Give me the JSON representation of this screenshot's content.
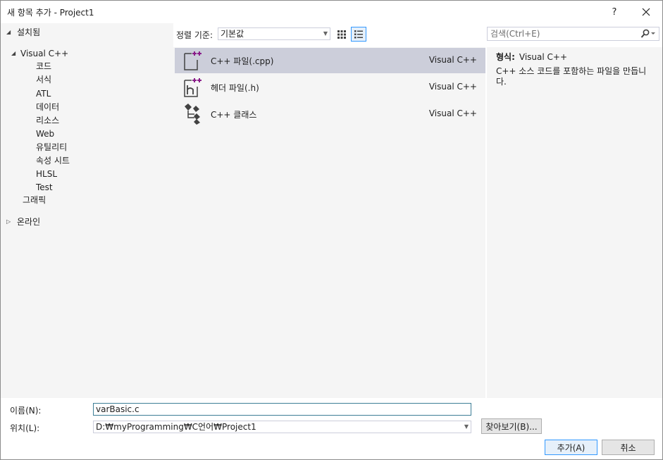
{
  "window": {
    "title": "새 항목 추가 - Project1",
    "help_glyph": "?",
    "close_glyph": "✕"
  },
  "tree": {
    "installed": "설치됨",
    "visual_cpp": "Visual C++",
    "children": [
      "코드",
      "서식",
      "ATL",
      "데이터",
      "리소스",
      "Web",
      "유틸리티",
      "속성 시트",
      "HLSL",
      "Test"
    ],
    "graphics": "그래픽",
    "online": "온라인",
    "expanded_glyph": "◢",
    "collapsed_glyph": "▷"
  },
  "toolbar": {
    "sort_label": "정렬 기준:",
    "sort_value": "기본값",
    "search_placeholder": "검색(Ctrl+E)"
  },
  "items": [
    {
      "name": "C++ 파일(.cpp)",
      "lang": "Visual C++",
      "selected": true,
      "icon": "cpp-file-icon"
    },
    {
      "name": "헤더 파일(.h)",
      "lang": "Visual C++",
      "selected": false,
      "icon": "header-file-icon"
    },
    {
      "name": "C++ 클래스",
      "lang": "Visual C++",
      "selected": false,
      "icon": "cpp-class-icon"
    }
  ],
  "detail": {
    "kind_label": "형식:",
    "kind_value": "Visual C++",
    "description": "C++ 소스 코드를 포함하는 파일을 만듭니다."
  },
  "form": {
    "name_label": "이름(N):",
    "name_value": "varBasic.c",
    "location_label": "위치(L):",
    "location_value": "D:₩myProgramming₩C언어₩Project1",
    "browse_label": "찾아보기(B)...",
    "add_label": "추가(A)",
    "cancel_label": "취소"
  },
  "colors": {
    "pane_bg": "#f5f5f5",
    "selection": "#ccceda",
    "accent": "#3399ff",
    "icon_plus": "#8a1e8a"
  }
}
